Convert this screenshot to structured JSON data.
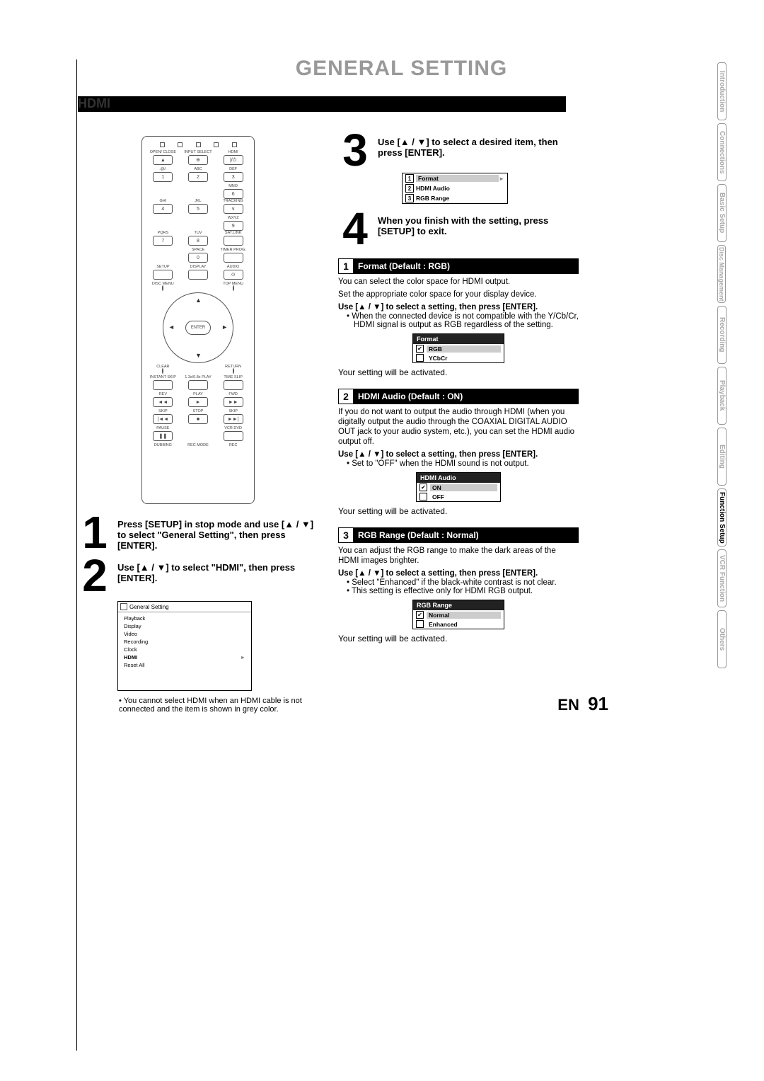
{
  "title": "GENERAL SETTING",
  "section_heading": "HDMI",
  "remote": {
    "r1": [
      "OPEN/\nCLOSE",
      "INPUT\nSELECT",
      "HDMI"
    ],
    "r2": [
      ".@/:",
      "ABC",
      "DEF"
    ],
    "k2": [
      "1",
      "2",
      "3"
    ],
    "r3": [
      "GHI",
      "JKL",
      "MNO"
    ],
    "k3": [
      "4",
      "5",
      "6"
    ],
    "r4": [
      "PQRS",
      "TUV",
      "WXYZ"
    ],
    "k4": [
      "7",
      "8",
      "9"
    ],
    "r5": [
      "",
      "SPACE",
      ""
    ],
    "k5": [
      "",
      "0",
      ""
    ],
    "r6": [
      "SETUP",
      "DISPLAY",
      "AUDIO"
    ],
    "disc_menu": "DISC MENU",
    "top_menu": "TOP MENU",
    "enter": "ENTER",
    "clear": "CLEAR",
    "return": "RETURN",
    "r7": [
      "INSTANT\nSKIP",
      "1.3x/0.8x\nPLAY",
      "TIME SLIP"
    ],
    "r8": [
      "REV",
      "PLAY",
      "FWD"
    ],
    "r9": [
      "SKIP",
      "STOP",
      "SKIP"
    ],
    "r10": [
      "PAUSE",
      "",
      "VCR   DVD"
    ],
    "r11": [
      "DUBBING",
      "REC MODE",
      "REC"
    ],
    "extra": [
      "TRACKING",
      "SAT.LINK",
      "TIMER\nPROG."
    ]
  },
  "steps_left": {
    "s1": "Press [SETUP] in stop mode and use [▲ / ▼] to select \"General Setting\", then press [ENTER].",
    "s2": "Use [▲ / ▼] to select \"HDMI\", then press [ENTER].",
    "s2_menu_title": "General Setting",
    "s2_menu_items": [
      "Playback",
      "Display",
      "Video",
      "Recording",
      "Clock",
      "HDMI",
      "Reset All"
    ],
    "s2_note": "You cannot select HDMI when an HDMI cable is not connected and the item is shown in grey color."
  },
  "steps_right": {
    "s3": "Use [▲ / ▼] to select a desired item, then press [ENTER].",
    "s3_items": [
      "Format",
      "HDMI Audio",
      "RGB Range"
    ],
    "s4": "When you finish with the setting, press [SETUP] to exit."
  },
  "sections": {
    "sec1": {
      "num": "1",
      "title": "Format (Default : RGB)",
      "p1": "You can select the color space for HDMI output.",
      "p2": "Set the appropriate color space for your display device.",
      "instr": "Use [▲ / ▼] to select a setting, then press [ENTER].",
      "bullet": "When the connected device is not compatible with the Y/Cb/Cr, HDMI signal is output as RGB regardless of the setting.",
      "menu_title": "Format",
      "opts": [
        "RGB",
        "YCbCr"
      ],
      "confirm": "Your setting will be activated."
    },
    "sec2": {
      "num": "2",
      "title": "HDMI Audio (Default : ON)",
      "p1": "If you do not want to output the audio through HDMI (when you digitally output the audio through the COAXIAL DIGITAL AUDIO OUT jack to your audio system, etc.), you can set the HDMI audio output off.",
      "instr": "Use [▲ / ▼] to select a setting, then press [ENTER].",
      "bullet": "Set to \"OFF\" when the HDMI sound is not output.",
      "menu_title": "HDMI Audio",
      "opts": [
        "ON",
        "OFF"
      ],
      "confirm": "Your setting will be activated."
    },
    "sec3": {
      "num": "3",
      "title": "RGB Range (Default : Normal)",
      "p1": "You can adjust the RGB range to make the dark areas of the HDMI images brighter.",
      "instr": "Use [▲ / ▼] to select a setting, then press [ENTER].",
      "bullet1": "Select \"Enhanced\" if the black-white contrast is not clear.",
      "bullet2": "This setting is effective only for HDMI RGB output.",
      "menu_title": "RGB Range",
      "opts": [
        "Normal",
        "Enhanced"
      ],
      "confirm": "Your setting will be activated."
    }
  },
  "side_tabs": [
    "Introduction",
    "Connections",
    "Basic Setup",
    "Disc\nManagement",
    "Recording",
    "Playback",
    "Editing",
    "Function Setup",
    "VCR Function",
    "Others"
  ],
  "footer": {
    "lang": "EN",
    "page": "91"
  }
}
